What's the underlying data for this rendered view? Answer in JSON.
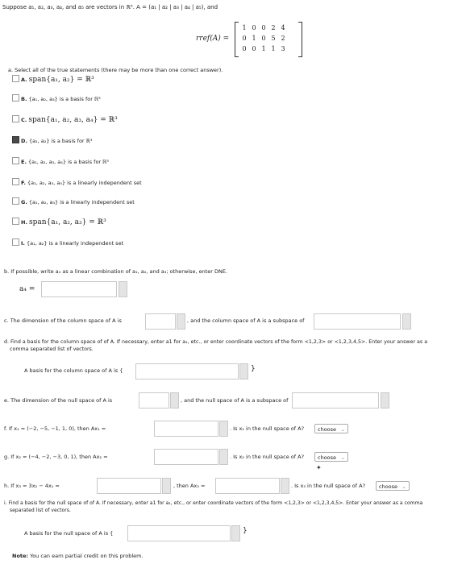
{
  "header": {
    "intro": "Suppose a₁, a₂, a₃, a₄, and a₅ are vectors in ℝ⁵. A = (a₁ | a₂ | a₃ | a₄ | a₅), and",
    "rref_label": "rref(A) ="
  },
  "matrix": {
    "rows": [
      [
        "1",
        "0",
        "0",
        "2",
        "4"
      ],
      [
        "0",
        "1",
        "0",
        "5",
        "2"
      ],
      [
        "0",
        "0",
        "1",
        "1",
        "3"
      ]
    ]
  },
  "part_a": {
    "prompt": "a. Select all of the true statements (there may be more than one correct answer).",
    "options": [
      {
        "letter": "A.",
        "text": "span{a₁, a₂} = ℝ³",
        "checked": false
      },
      {
        "letter": "B.",
        "text": "{a₁, a₂, a₃} is a basis for ℝ³",
        "checked": false
      },
      {
        "letter": "C.",
        "text": "span{a₁, a₂, a₃, a₄} = ℝ³",
        "checked": false
      },
      {
        "letter": "D.",
        "text": "{a₁, a₂} is a basis for ℝ³",
        "checked": true
      },
      {
        "letter": "E.",
        "text": "{a₁, a₂, a₃, a₄} is a basis for ℝ³",
        "checked": false
      },
      {
        "letter": "F.",
        "text": "{a₁, a₂, a₃, a₄} is a linearly independent set",
        "checked": false
      },
      {
        "letter": "G.",
        "text": "{a₁, a₂, a₃} is a linearly independent set",
        "checked": false
      },
      {
        "letter": "H.",
        "text": "span{a₁, a₂, a₃} = ℝ³",
        "checked": false
      },
      {
        "letter": "I.",
        "text": "{a₁, a₂} is a linearly independent set",
        "checked": false
      }
    ]
  },
  "part_b": {
    "prompt": "b. If possible, write a₄ as a linear combination of a₁, a₂, and a₃; otherwise, enter DNE.",
    "label": "a₄ ="
  },
  "part_c": {
    "text1": "c. The dimension of the column space of A is",
    "text2": ", and the column space of A is a subspace of"
  },
  "part_d": {
    "prompt_line1": "d. Find a basis for the column space of of A. If necessary, enter a1 for a₁, etc., or enter coordinate vectors of the form <1,2,3> or <1,2,3,4,5>. Enter your answer as a",
    "prompt_line2": "comma separated list of vectors.",
    "label": "A basis for the column space of A is {",
    "close": "}"
  },
  "part_e": {
    "text1": "e. The dimension of the null space of A is",
    "text2": ", and the null space of A is a subspace of"
  },
  "part_f": {
    "label": "f. If x₁ = (−2, −5, −1, 1, 0), then Ax₁ =",
    "question": ". Is x₁ in the null space of A?",
    "select": "choose"
  },
  "part_g": {
    "label": "g. If x₂ = (−4, −2, −3, 0, 1), then Ax₂ =",
    "question": ". Is x₂ in the null space of A?",
    "select": "choose"
  },
  "part_h": {
    "label": "h. If x₃ = 3x₂ − 4x₁ =",
    "mid": ", then Ax₃ =",
    "question": ". Is x₃ in the null space of A?",
    "select": "choose"
  },
  "part_i": {
    "prompt_line1": "i. Find a basis for the null space of of A. If necessary, enter a1 for a₁, etc., or enter coordinate vectors of the form <1,2,3> or <1,2,3,4,5>. Enter your answer as a comma",
    "prompt_line2": "separated list of vectors.",
    "label": "A basis for the null space of A is {",
    "close": "}"
  },
  "note": {
    "bold": "Note:",
    "text": " You can earn partial credit on this problem."
  }
}
